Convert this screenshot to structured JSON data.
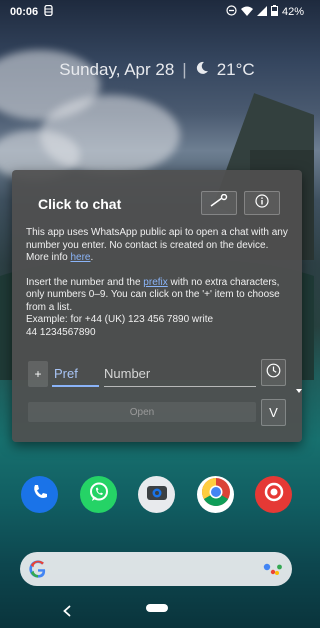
{
  "status": {
    "time": "00:06",
    "battery": "42%"
  },
  "glance": {
    "date": "Sunday, Apr 28",
    "separator": "|",
    "temperature": "21°C"
  },
  "dialog": {
    "title": "Click to chat",
    "intro": "This app uses WhatsApp public api to open a chat with any number you enter. No contact is created on the device.",
    "more_info_prefix": "More info ",
    "more_info_link": "here",
    "more_info_suffix": ".",
    "instr_1": "Insert the number and the ",
    "instr_link": "prefix",
    "instr_2": " with no extra characters, only numbers 0–9. You can click on the '+' item to choose from a list.",
    "example_line1": "Example: for +44 (UK) 123 456 7890 write",
    "example_line2": "44 1234567890",
    "plus_label": "+",
    "prefix_placeholder": "Pref",
    "number_placeholder": "Number",
    "open_label": "Open",
    "v_label": "V"
  },
  "icons": {
    "settings": "wrench-icon",
    "info": "info-icon",
    "history": "clock-icon"
  },
  "dock_apps": [
    "phone",
    "whatsapp",
    "camera",
    "chrome",
    "app"
  ],
  "colors": {
    "link": "#8ab4f8",
    "whatsapp": "#25d366",
    "phone": "#1a73e8",
    "camera": "#e8eaed",
    "app_red": "#e53935"
  }
}
